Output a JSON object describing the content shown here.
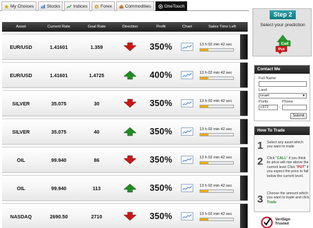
{
  "tabs": [
    {
      "label": "My Choices",
      "icon": "star-icon",
      "active": false
    },
    {
      "label": "Stocks",
      "icon": "stocks-icon",
      "active": false
    },
    {
      "label": "Indices",
      "icon": "indices-icon",
      "active": false
    },
    {
      "label": "Forex",
      "icon": "forex-icon",
      "active": false
    },
    {
      "label": "Commodities",
      "icon": "commodities-icon",
      "active": false
    },
    {
      "label": "OneTouch",
      "icon": "onetouch-icon",
      "active": true
    }
  ],
  "table": {
    "headers": {
      "asset": "Asset",
      "current_rate": "Current Rate",
      "goal_rate": "Goal Rate",
      "direction": "Direction",
      "profit": "Profit",
      "chart": "Chart",
      "sales_time_left": "Sales Time Left"
    },
    "rows": [
      {
        "asset": "EUR/USD",
        "current_rate": "1.41601",
        "goal_rate": "1.359",
        "direction": "down",
        "profit": "350%",
        "time_left": "13 h 02 min 42 sec",
        "progress": 0.25
      },
      {
        "asset": "EUR/USD",
        "current_rate": "1.41601",
        "goal_rate": "1.4725",
        "direction": "up",
        "profit": "400%",
        "time_left": "13 h 02 min 42 sec",
        "progress": 0.25
      },
      {
        "asset": "SILVER",
        "current_rate": "35.075",
        "goal_rate": "30",
        "direction": "down",
        "profit": "350%",
        "time_left": "13 h 02 min 42 sec",
        "progress": 0.25
      },
      {
        "asset": "SILVER",
        "current_rate": "35.075",
        "goal_rate": "40",
        "direction": "up",
        "profit": "350%",
        "time_left": "13 h 02 min 42 sec",
        "progress": 0.25
      },
      {
        "asset": "OIL",
        "current_rate": "99.940",
        "goal_rate": "86",
        "direction": "down",
        "profit": "350%",
        "time_left": "13 h 02 min 42 sec",
        "progress": 0.25
      },
      {
        "asset": "OIL",
        "current_rate": "99.940",
        "goal_rate": "113",
        "direction": "up",
        "profit": "350%",
        "time_left": "13 h 02 min 42 sec",
        "progress": 0.25
      },
      {
        "asset": "NASDAQ",
        "current_rate": "2690.50",
        "goal_rate": "2710",
        "direction": "down",
        "profit": "350%",
        "time_left": "13 h 02 min 42 sec",
        "progress": 0.25
      }
    ]
  },
  "step_box": {
    "title": "Step 2",
    "subtitle": "Select your prediction",
    "call_label": "Call",
    "put_label": "Put"
  },
  "contact": {
    "title": "Contact Me",
    "full_name_label": "Full Name",
    "full_name_value": "",
    "land_label": "Land",
    "land_value": "Israel",
    "prefix_label": "Prefix",
    "prefix_value": "+972",
    "phone_label": "Phone",
    "phone_value": "",
    "submit_label": "Submit"
  },
  "how_to": {
    "title": "How To Trade",
    "steps": [
      {
        "num": "1",
        "text": "Select any asset which you want to trade"
      },
      {
        "num": "2",
        "pre": "Click \"",
        "call": "CALL",
        "mid": "\" if you think its price will rise above the current level Click \"",
        "put": "PUT",
        "post": "\" if you expect the price to fall below the current level."
      },
      {
        "num": "3",
        "pre": "Choose the amount which you want to trade and click ",
        "trade": "Trade"
      }
    ]
  },
  "verisign": {
    "line1": "VeriSign",
    "line2": "Trusted"
  },
  "colors": {
    "up": "#1e8e1e",
    "down": "#d01414",
    "progress": "#f4a900",
    "step_title": "#128088"
  }
}
